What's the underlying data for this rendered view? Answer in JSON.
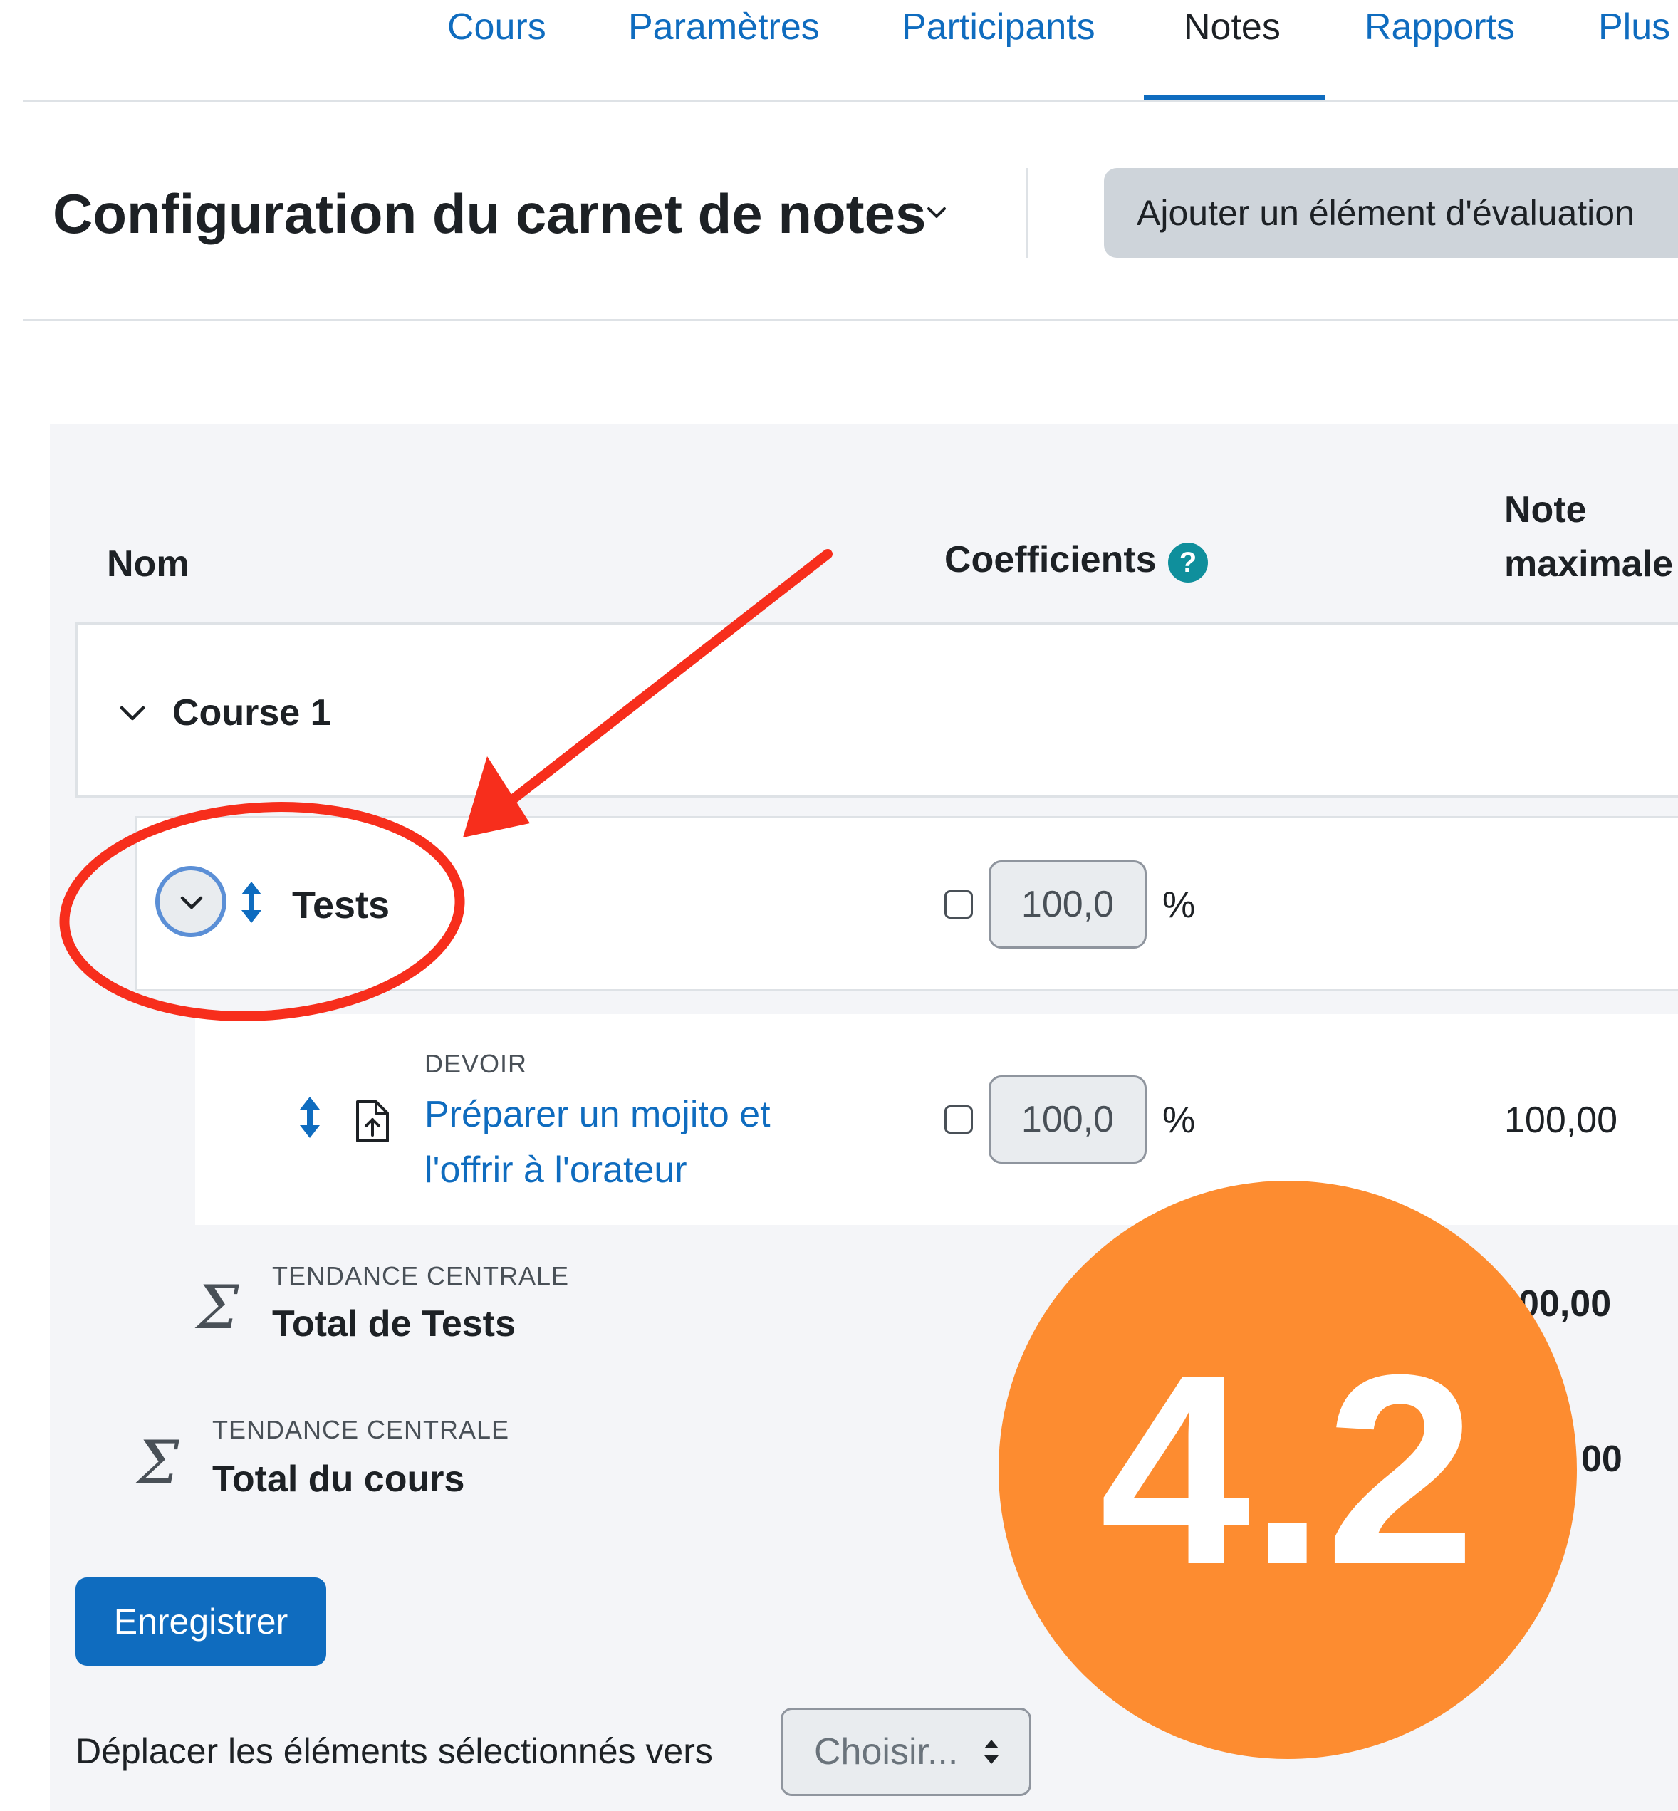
{
  "nav": {
    "items": [
      {
        "label": "Cours"
      },
      {
        "label": "Paramètres"
      },
      {
        "label": "Participants"
      },
      {
        "label": "Notes"
      },
      {
        "label": "Rapports"
      },
      {
        "label": "Plus"
      }
    ],
    "active": "Notes"
  },
  "header": {
    "title": "Configuration du carnet de notes",
    "add_button": "Ajouter un élément d'évaluation"
  },
  "table": {
    "col_name": "Nom",
    "col_weights": "Coefficients",
    "col_max_1": "Note",
    "col_max_2": "maximale",
    "help_glyph": "?",
    "course_row": {
      "label": "Course 1"
    },
    "category_row": {
      "label": "Tests",
      "weight": "100,0",
      "unit": "%"
    },
    "item_row": {
      "type": "DEVOIR",
      "name_line1": "Préparer un mojito et",
      "name_line2": "l'offrir à l'orateur",
      "weight": "100,0",
      "unit": "%",
      "max_grade": "100,00"
    },
    "category_total": {
      "type": "TENDANCE CENTRALE",
      "label": "Total de Tests",
      "max_grade_partial": "00,00"
    },
    "course_total": {
      "type": "TENDANCE CENTRALE",
      "label": "Total du cours",
      "max_grade_partial": "00"
    }
  },
  "footer": {
    "save_button": "Enregistrer",
    "move_label": "Déplacer les éléments sélectionnés vers",
    "move_select": "Choisir..."
  },
  "overlay": {
    "badge": "4.2",
    "arrow_color": "#f72e1c",
    "badge_color": "#fd8c30"
  },
  "icons": {
    "help": "help-icon",
    "expand": "chevron-down-icon",
    "move": "move-arrows-icon",
    "assignment": "assignment-upload-icon",
    "aggregation": "sigma-icon"
  },
  "colors": {
    "link": "#0f6cbf",
    "primary": "#0f6cbf",
    "panel": "#f4f5f8"
  }
}
